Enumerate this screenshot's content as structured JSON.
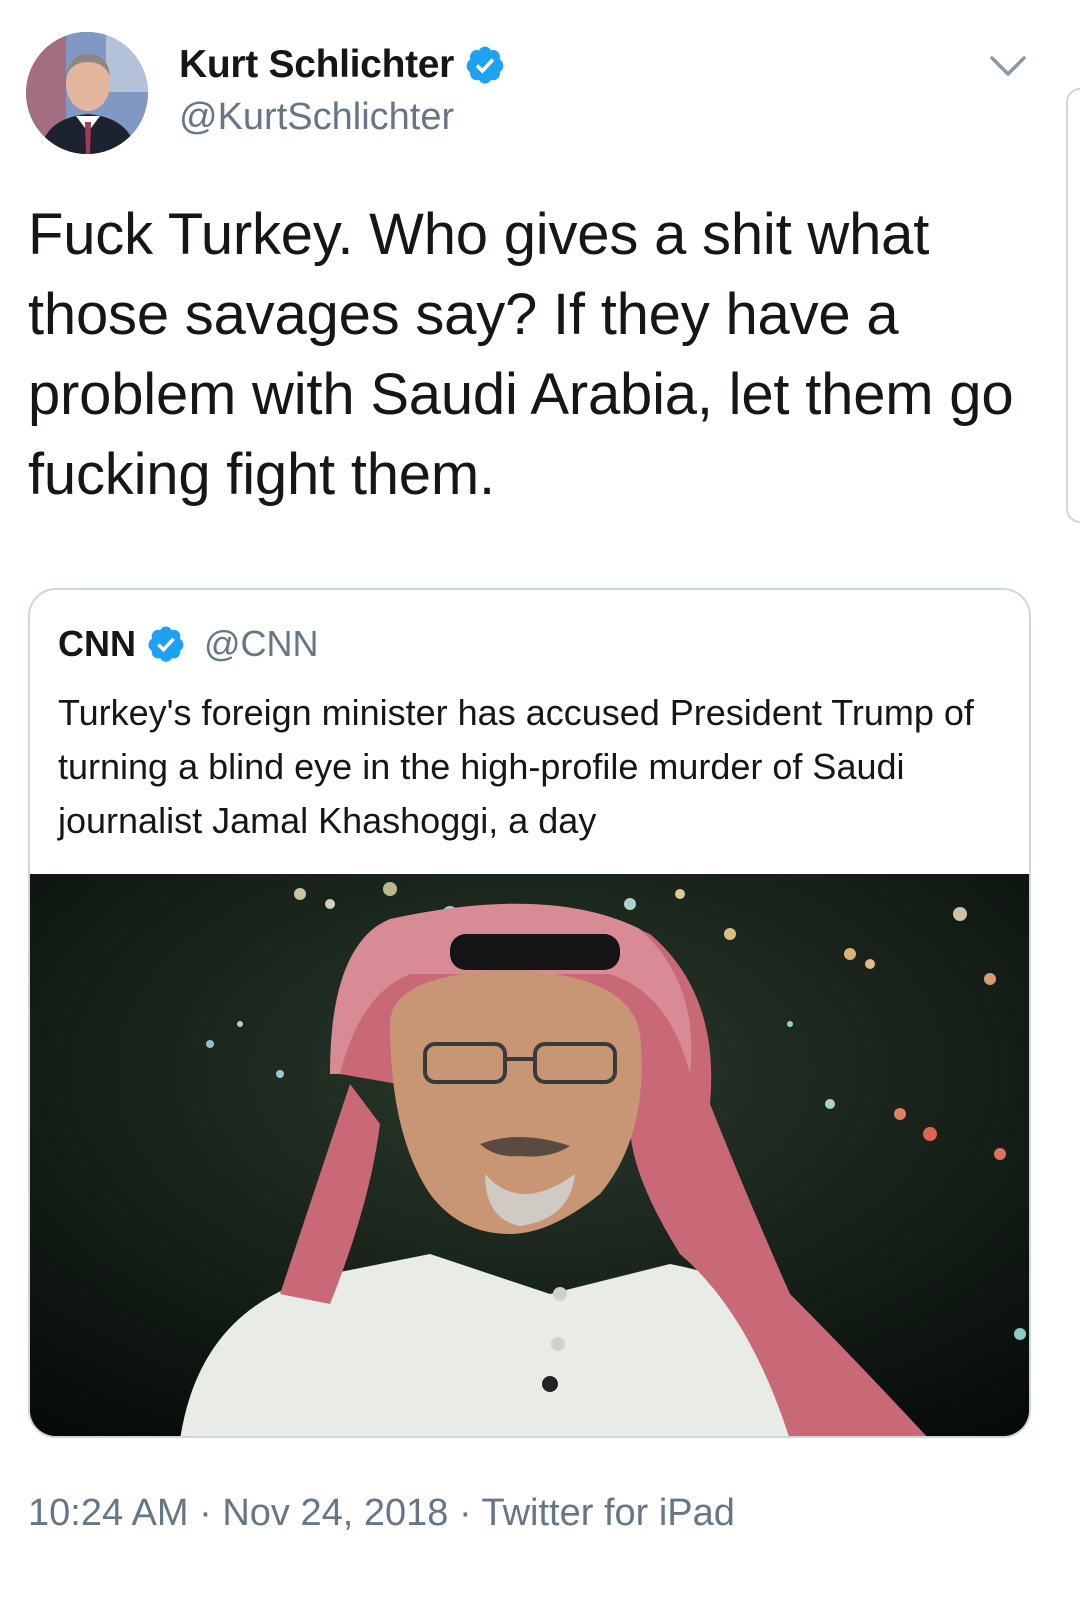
{
  "tweet": {
    "author": {
      "display_name": "Kurt Schlichter",
      "handle": "@KurtSchlichter",
      "verified": true
    },
    "text": "Fuck Turkey. Who gives a shit what those savages say? If they have a problem with Saudi Arabia, let them go fucking fight them.",
    "timestamp": "10:24 AM",
    "date": "Nov 24, 2018",
    "source": "Twitter for iPad",
    "separator": "·"
  },
  "quoted_tweet": {
    "author": {
      "display_name": "CNN",
      "handle": "@CNN",
      "verified": true
    },
    "text": "Turkey's foreign minister has accused President Trump of turning a blind eye in the high-profile murder of Saudi journalist Jamal Khashoggi, a day"
  },
  "icons": {
    "verified": "verified-badge-icon",
    "menu": "chevron-down-icon"
  },
  "colors": {
    "verified_blue": "#1da1f2",
    "secondary_text": "#657786",
    "primary_text": "#14171a",
    "border": "#ccd6dd"
  }
}
